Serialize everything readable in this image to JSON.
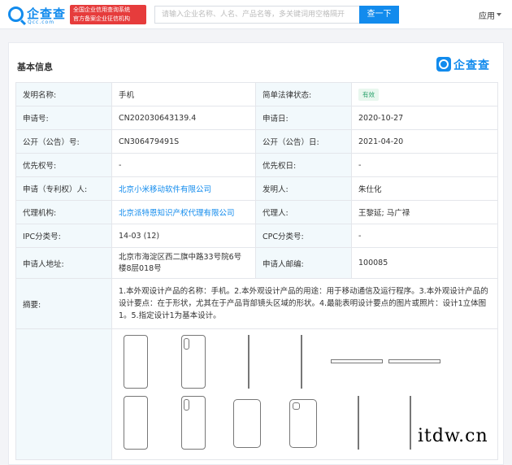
{
  "header": {
    "logo_text": "企查查",
    "logo_sub": "Qcc.com",
    "badge_line1": "全国企业信用查询系统",
    "badge_line2": "官方备案企业征信机构",
    "search_placeholder": "请输入企业名称、人名、产品名等，多关键词用空格隔开",
    "search_button": "查一下",
    "app_menu": "应用"
  },
  "section": {
    "title": "基本信息",
    "brand": "企查查"
  },
  "rows": {
    "r1": {
      "l1": "发明名称:",
      "v1": "手机",
      "l2": "简单法律状态:",
      "v2": "有效"
    },
    "r2": {
      "l1": "申请号:",
      "v1": "CN202030643139.4",
      "l2": "申请日:",
      "v2": "2020-10-27"
    },
    "r3": {
      "l1": "公开（公告）号:",
      "v1": "CN306479491S",
      "l2": "公开（公告）日:",
      "v2": "2021-04-20"
    },
    "r4": {
      "l1": "优先权号:",
      "v1": "-",
      "l2": "优先权日:",
      "v2": "-"
    },
    "r5": {
      "l1": "申请（专利权）人:",
      "v1": "北京小米移动软件有限公司",
      "l2": "发明人:",
      "v2": "朱仕化"
    },
    "r6": {
      "l1": "代理机构:",
      "v1": "北京派特恩知识产权代理有限公司",
      "l2": "代理人:",
      "v2": "王黎延; 马广禄"
    },
    "r7": {
      "l1": "IPC分类号:",
      "v1": "14-03 (12)",
      "l2": "CPC分类号:",
      "v2": "-"
    },
    "r8": {
      "l1": "申请人地址:",
      "v1": "北京市海淀区西二旗中路33号院6号楼8层018号",
      "l2": "申请人邮编:",
      "v2": "100085"
    },
    "r9": {
      "l1": "摘要:",
      "v1": "1.本外观设计产品的名称：手机。2.本外观设计产品的用途：用于移动通信及运行程序。3.本外观设计产品的设计要点：在于形状，尤其在于产品背部镜头区域的形状。4.最能表明设计要点的图片或照片：设计1立体图1。5.指定设计1为基本设计。"
    }
  },
  "watermark": "itdw.cn"
}
